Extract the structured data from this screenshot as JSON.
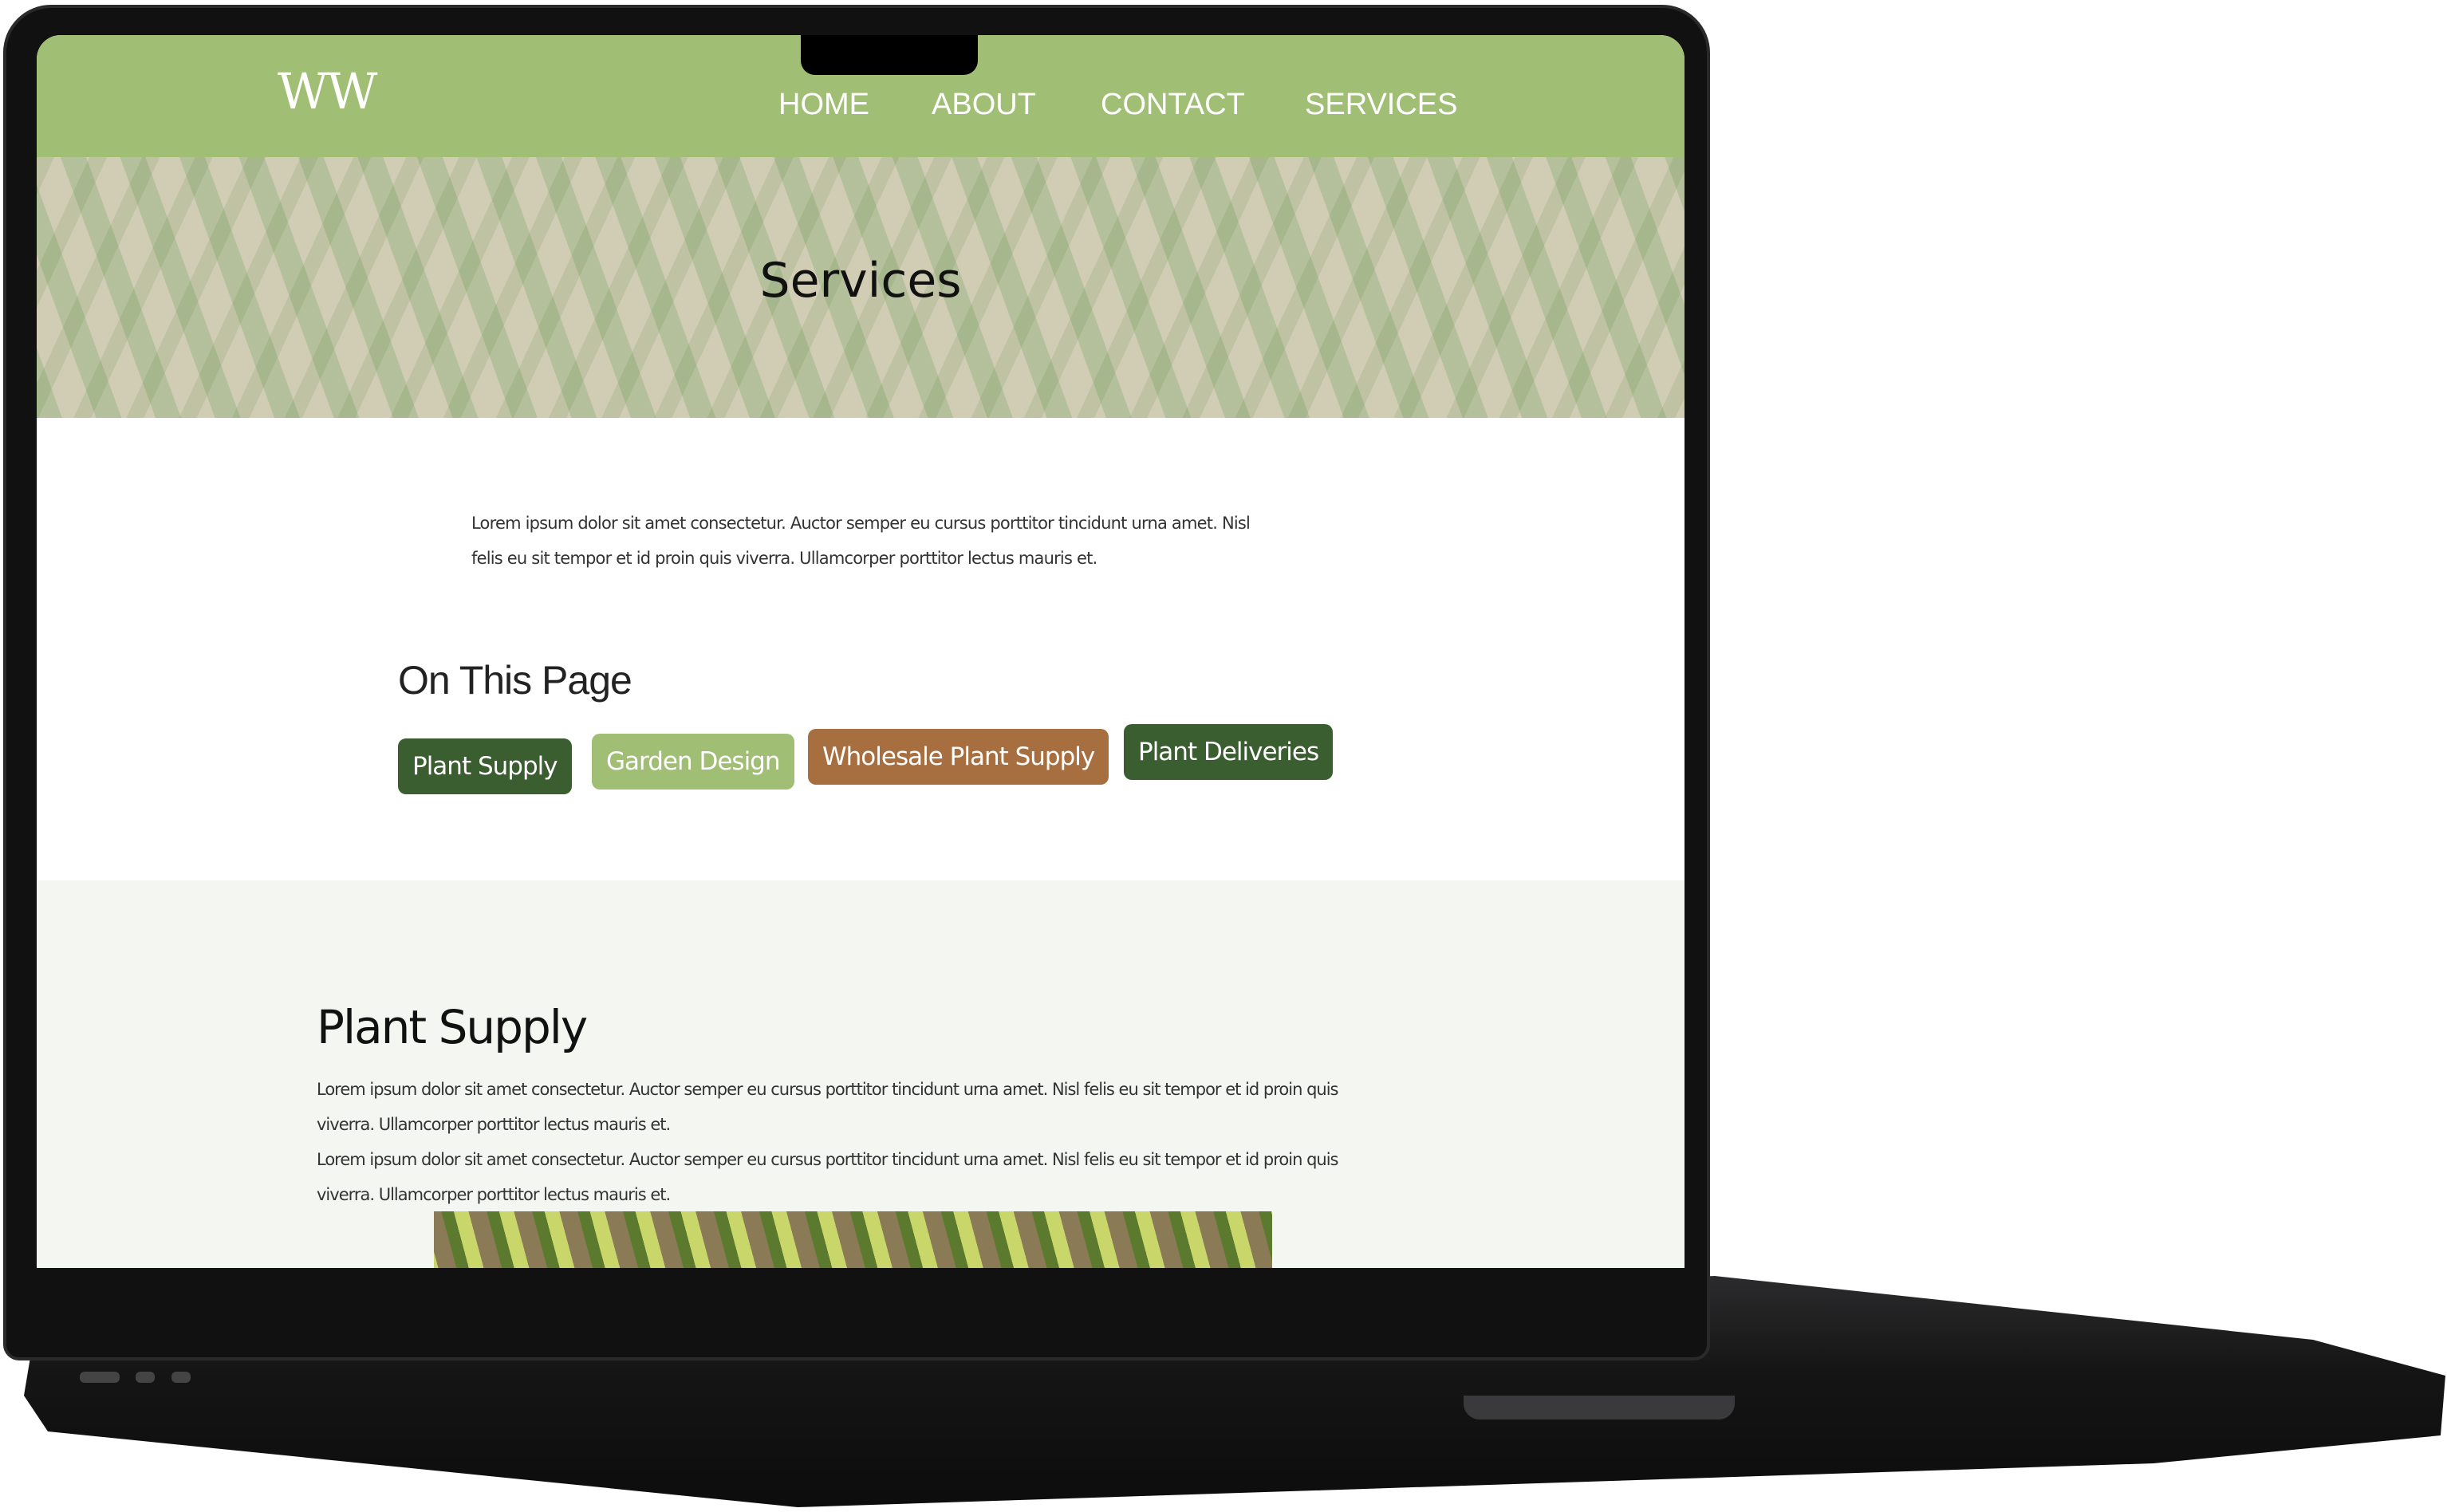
{
  "site": {
    "logo": "WW",
    "nav": [
      "HOME",
      "ABOUT",
      "CONTACT",
      "SERVICES"
    ]
  },
  "hero": {
    "title": "Services"
  },
  "intro": "Lorem ipsum dolor sit amet consectetur. Auctor semper eu cursus porttitor tincidunt urna amet. Nisl felis eu sit tempor et id proin quis viverra. Ullamcorper porttitor lectus mauris et.",
  "on_this_page": {
    "title": "On This Page",
    "buttons": [
      {
        "label": "Plant Supply",
        "color": "#3b5e31"
      },
      {
        "label": "Garden Design",
        "color": "#a1bf74"
      },
      {
        "label": "Wholesale Plant Supply",
        "color": "#a76e3f"
      },
      {
        "label": "Plant Deliveries",
        "color": "#3b5e31"
      }
    ]
  },
  "plant_supply": {
    "title": "Plant Supply",
    "p1": "Lorem ipsum dolor sit amet consectetur. Auctor semper eu cursus porttitor tincidunt urna amet. Nisl felis eu sit tempor et id proin quis viverra. Ullamcorper porttitor lectus mauris et.",
    "p2": "Lorem ipsum dolor sit amet consectetur. Auctor semper eu cursus porttitor tincidunt urna amet. Nisl felis eu sit tempor et id proin quis viverra. Ullamcorper porttitor lectus mauris et."
  }
}
